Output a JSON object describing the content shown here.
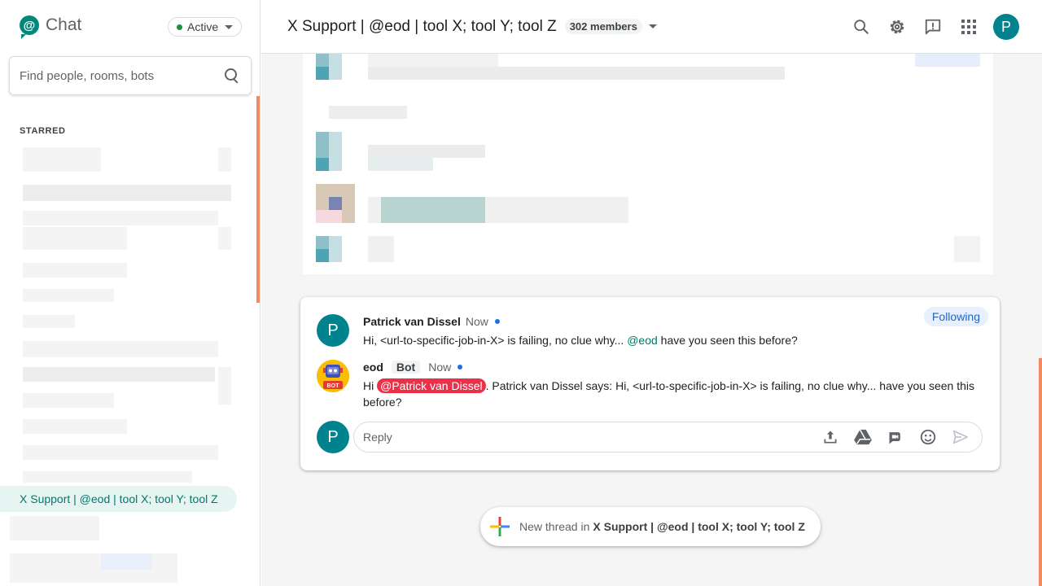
{
  "app": {
    "name": "Chat",
    "logo_glyph": "@",
    "status": "Active"
  },
  "sidebar": {
    "search_placeholder": "Find people, rooms, bots",
    "starred_label": "STARRED",
    "active_room": "X Support | @eod | tool X; tool Y; tool Z"
  },
  "header": {
    "room_title": "X Support | @eod | tool X; tool Y; tool Z",
    "members": "302 members",
    "user_initial": "P",
    "icons": [
      "search-icon",
      "gear-icon",
      "feedback-icon",
      "apps-grid-icon"
    ]
  },
  "thread": {
    "following_label": "Following",
    "messages": [
      {
        "initial": "P",
        "sender": "Patrick van Dissel",
        "time": "Now",
        "text_before": "Hi, <url-to-specific-job-in-X> is failing, no clue why... ",
        "mention": "@eod",
        "text_after": " have you seen this before?"
      },
      {
        "sender": "eod",
        "badge": "Bot",
        "time": "Now",
        "bot_avatar_label": "BOT",
        "text_before": "Hi ",
        "mention": "@Patrick van Dissel",
        "text_after": ". Patrick van Dissel says: Hi, <url-to-specific-job-in-X> is failing, no clue why...  have you seen this before?"
      }
    ],
    "reply_initial": "P",
    "reply_placeholder": "Reply"
  },
  "new_thread": {
    "prefix": "New thread in",
    "room": "X Support | @eod | tool X; tool Y; tool Z"
  },
  "colors": {
    "accent": "#00897b",
    "avatar": "#00838f",
    "mention_red": "#ea3149",
    "following_bg": "#e8f0fe",
    "scroll_accent": "#f28b63"
  }
}
